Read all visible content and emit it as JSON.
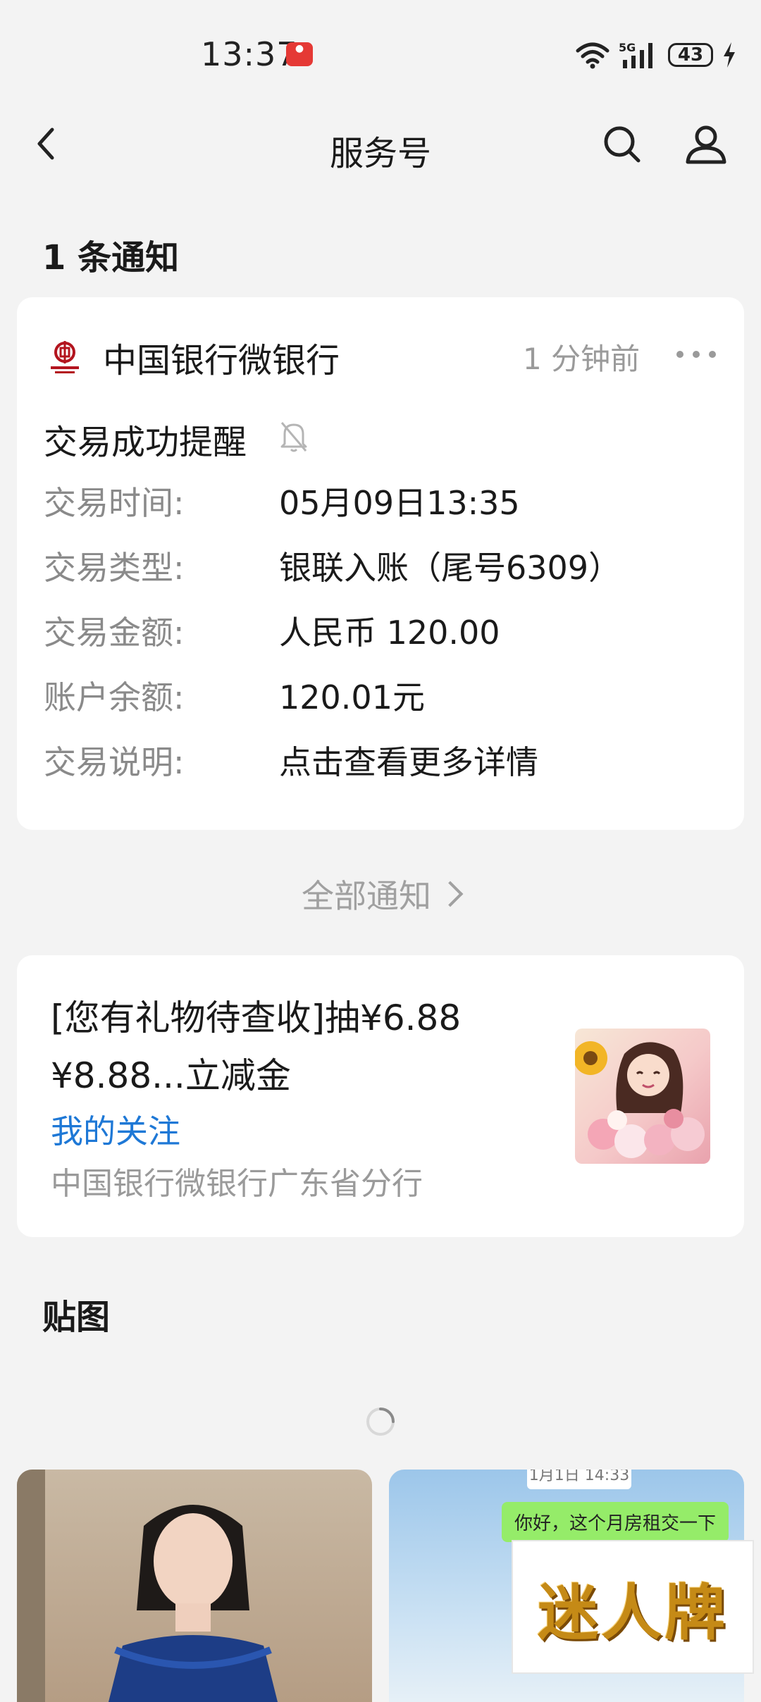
{
  "status_bar": {
    "time": "13:37",
    "network": "5G",
    "battery": "43"
  },
  "nav": {
    "title": "服务号"
  },
  "notice_section": {
    "title": "1 条通知"
  },
  "notice_card": {
    "bank_name": "中国银行微银行",
    "time_ago": "1 分钟前",
    "title": "交易成功提醒",
    "rows": [
      {
        "label": "交易时间:",
        "value": "05月09日13:35"
      },
      {
        "label": "交易类型:",
        "value": "银联入账（尾号6309）"
      },
      {
        "label": "交易金额:",
        "value": "人民币 120.00"
      },
      {
        "label": "账户余额:",
        "value": "120.01元"
      },
      {
        "label": "交易说明:",
        "value": "点击查看更多详情"
      }
    ]
  },
  "all_notices": "全部通知",
  "promo": {
    "title": "[您有礼物待查收]抽¥6.88 ¥8.88...立减金",
    "follow_label": "我的关注",
    "source": "中国银行微银行广东省分行"
  },
  "stickers": {
    "title": "贴图",
    "chat_preview_text": "你好，这个月房租交一下",
    "chat_preview_time": "1月1日 14:33"
  },
  "watermark_text": "迷人牌",
  "colors": {
    "link": "#1e78d6",
    "muted": "#9a9a9a",
    "background": "#f3f3f3",
    "card": "#ffffff"
  }
}
